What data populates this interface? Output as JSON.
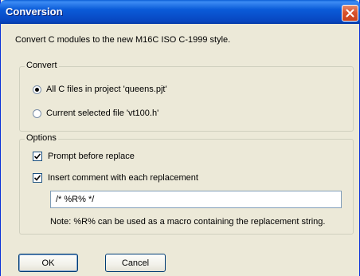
{
  "dialog": {
    "title": "Conversion",
    "description": "Convert C modules to the new M16C ISO C-1999 style."
  },
  "convert_group": {
    "label": "Convert",
    "options": [
      {
        "label": "All C files in project 'queens.pjt'",
        "selected": true
      },
      {
        "label": "Current selected file 'vt100.h'",
        "selected": false
      }
    ]
  },
  "options_group": {
    "label": "Options",
    "prompt_label": "Prompt before replace",
    "prompt_checked": true,
    "comment_label": "Insert comment with each replacement",
    "comment_checked": true,
    "comment_value": "/* %R% */",
    "note": "Note: %R% can be used as a macro containing the replacement string."
  },
  "buttons": {
    "ok": "OK",
    "cancel": "Cancel"
  },
  "colors": {
    "titlebar": "#0a5bd8",
    "dialog_bg": "#ece9d8",
    "close_button": "#d8542e",
    "button_border": "#003c74"
  }
}
